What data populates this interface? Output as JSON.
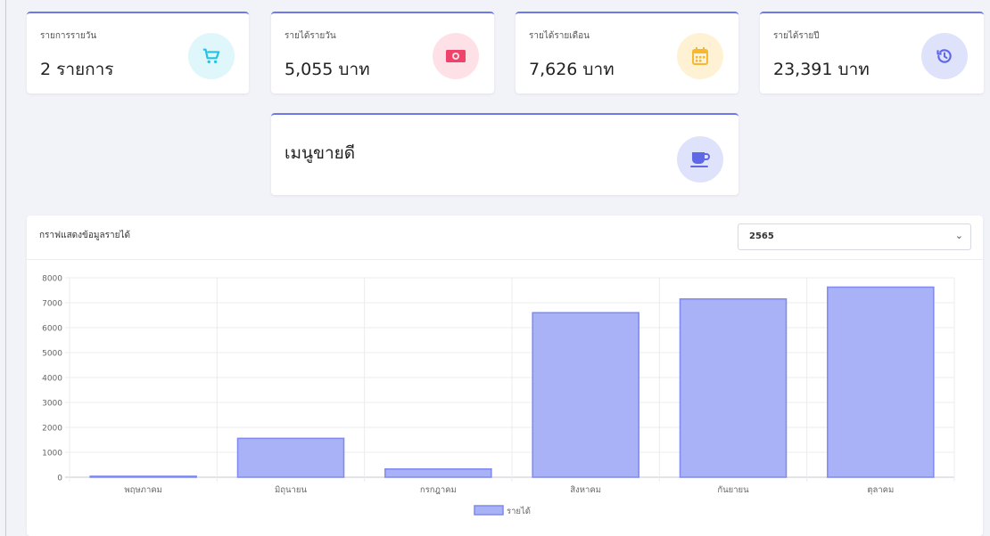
{
  "stats": [
    {
      "label": "รายการรายวัน",
      "value": "2 รายการ",
      "icon": "cart-icon",
      "icon_glyph": "🛒",
      "icon_bg": "#dff6fb",
      "icon_color": "#22c3e6"
    },
    {
      "label": "รายได้รายวัน",
      "value": "5,055 บาท",
      "icon": "money-icon",
      "icon_glyph": "💵",
      "icon_bg": "#fde1e6",
      "icon_color": "#f0436a"
    },
    {
      "label": "รายได้รายเดือน",
      "value": "7,626 บาท",
      "icon": "calendar-icon",
      "icon_glyph": "📅",
      "icon_bg": "#fff2d4",
      "icon_color": "#f5b82e"
    },
    {
      "label": "รายได้รายปี",
      "value": "23,391 บาท",
      "icon": "history-icon",
      "icon_glyph": "⟲",
      "icon_bg": "#dfe2fb",
      "icon_color": "#5f68e6"
    }
  ],
  "best_seller": {
    "title": "เมนูขายดี",
    "icon": "coffee-cup-icon",
    "icon_glyph": "☕",
    "icon_bg": "#dfe2fb",
    "icon_color": "#5f68e6"
  },
  "chart_panel": {
    "title": "กราฟแสดงข้อมูลรายได้",
    "year_select": {
      "value": "2565",
      "options": [
        "2565"
      ]
    }
  },
  "colors": {
    "accent": "#6f78e8",
    "bar_fill": "#a9b1f7",
    "bar_stroke": "#7f89ee"
  },
  "chart_data": {
    "type": "bar",
    "categories": [
      "พฤษภาคม",
      "มิถุนายน",
      "กรกฎาคม",
      "สิงหาคม",
      "กันยายน",
      "ตุลาคม"
    ],
    "series": [
      {
        "name": "รายได้",
        "values": [
          40,
          1560,
          330,
          6600,
          7150,
          7626
        ]
      }
    ],
    "yticks": [
      "0",
      "1000",
      "2000",
      "3000",
      "4000",
      "5000",
      "6000",
      "7000",
      "8000"
    ],
    "ylim": [
      0,
      8000
    ],
    "grid": true,
    "legend": "bottom"
  }
}
